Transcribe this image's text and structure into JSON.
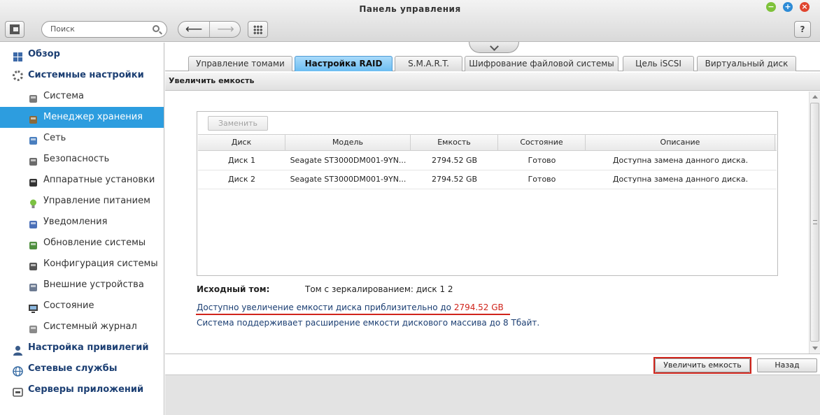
{
  "window": {
    "title": "Панель управления"
  },
  "toolbar": {
    "search_placeholder": "Поиск",
    "help_label": "?"
  },
  "sidebar": {
    "items": [
      {
        "label": "Обзор",
        "level": "top",
        "icon": "overview-icon"
      },
      {
        "label": "Системные настройки",
        "level": "top",
        "icon": "gear-icon"
      },
      {
        "label": "Система",
        "level": "sub",
        "icon": "system-icon"
      },
      {
        "label": "Менеджер хранения",
        "level": "sub",
        "icon": "storage-icon",
        "active": true
      },
      {
        "label": "Сеть",
        "level": "sub",
        "icon": "network-icon"
      },
      {
        "label": "Безопасность",
        "level": "sub",
        "icon": "lock-icon"
      },
      {
        "label": "Аппаратные установки",
        "level": "sub",
        "icon": "hardware-icon"
      },
      {
        "label": "Управление питанием",
        "level": "sub",
        "icon": "power-bulb-icon"
      },
      {
        "label": "Уведомления",
        "level": "sub",
        "icon": "notification-icon"
      },
      {
        "label": "Обновление системы",
        "level": "sub",
        "icon": "update-icon"
      },
      {
        "label": "Конфигурация системы",
        "level": "sub",
        "icon": "config-icon"
      },
      {
        "label": "Внешние устройства",
        "level": "sub",
        "icon": "external-device-icon"
      },
      {
        "label": "Состояние",
        "level": "sub",
        "icon": "monitor-icon"
      },
      {
        "label": "Системный журнал",
        "level": "sub",
        "icon": "log-icon"
      },
      {
        "label": "Настройка привилегий",
        "level": "top",
        "icon": "user-icon"
      },
      {
        "label": "Сетевые службы",
        "level": "top",
        "icon": "globe-icon"
      },
      {
        "label": "Серверы приложений",
        "level": "top",
        "icon": "server-icon"
      }
    ]
  },
  "tabs": [
    {
      "label": "Управление томами"
    },
    {
      "label": "Настройка RAID",
      "active": true
    },
    {
      "label": "S.M.A.R.T."
    },
    {
      "label": "Шифрование файловой системы"
    },
    {
      "label": "Цель iSCSI"
    },
    {
      "label": "Виртуальный диск"
    }
  ],
  "section": {
    "title": "Увеличить емкость"
  },
  "panel": {
    "replace_label": "Заменить",
    "columns": [
      "Диск",
      "Модель",
      "Емкость",
      "Состояние",
      "Описание"
    ],
    "rows": [
      {
        "disk": "Диск 1",
        "model": "Seagate ST3000DM001-9YN...",
        "capacity": "2794.52 GB",
        "status": "Готово",
        "description": "Доступна замена данного диска."
      },
      {
        "disk": "Диск 2",
        "model": "Seagate ST3000DM001-9YN...",
        "capacity": "2794.52 GB",
        "status": "Готово",
        "description": "Доступна замена данного диска."
      }
    ]
  },
  "info": {
    "source_label": "Исходный том:",
    "source_value": "Том с зеркалированием: диск 1 2",
    "line1_prefix": "Доступно увеличение емкости диска приблизительно до ",
    "line1_value": "2794.52 GB",
    "line2": "Система поддерживает расширение емкости дискового массива до 8 Тбайт."
  },
  "footer": {
    "expand_label": "Увеличить емкость",
    "back_label": "Назад"
  },
  "colors": {
    "accent": "#2d9ddf",
    "highlight": "#d0241b",
    "text_link": "#1c3f73"
  }
}
